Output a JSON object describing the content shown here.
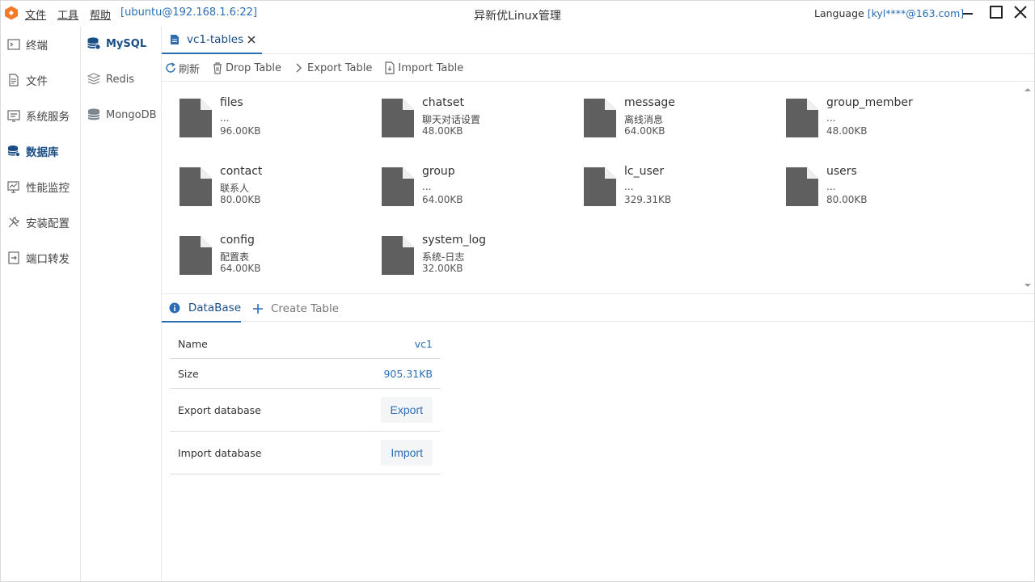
{
  "titlebar": {
    "menus": [
      "文件",
      "工具",
      "帮助"
    ],
    "connection": "[ubuntu@192.168.1.6:22]",
    "title": "异新优Linux管理",
    "language_label": "Language",
    "account": "[kyl****@163.com]"
  },
  "sidebar": {
    "items": [
      {
        "label": "终端",
        "icon": "terminal-icon"
      },
      {
        "label": "文件",
        "icon": "file-icon"
      },
      {
        "label": "系统服务",
        "icon": "service-icon"
      },
      {
        "label": "数据库",
        "icon": "database-icon"
      },
      {
        "label": "性能监控",
        "icon": "monitor-icon"
      },
      {
        "label": "安装配置",
        "icon": "tools-icon"
      },
      {
        "label": "端口转发",
        "icon": "port-forward-icon"
      }
    ],
    "active": "数据库"
  },
  "db_types": {
    "items": [
      {
        "label": "MySQL",
        "icon": "mysql-icon"
      },
      {
        "label": "Redis",
        "icon": "redis-icon"
      },
      {
        "label": "MongoDB",
        "icon": "mongodb-icon"
      }
    ],
    "active": "MySQL"
  },
  "tab": {
    "label": "vc1-tables"
  },
  "toolbar": {
    "refresh": "刷新",
    "drop": "Drop Table",
    "export": "Export Table",
    "import": "Import Table"
  },
  "tables": [
    {
      "name": "files",
      "comment": "...",
      "size": "96.00KB"
    },
    {
      "name": "chatset",
      "comment": "聊天对话设置",
      "size": "48.00KB"
    },
    {
      "name": "message",
      "comment": "离线消息",
      "size": "64.00KB"
    },
    {
      "name": "group_member",
      "comment": "...",
      "size": "48.00KB"
    },
    {
      "name": "contact",
      "comment": "联系人",
      "size": "80.00KB"
    },
    {
      "name": "group",
      "comment": "...",
      "size": "64.00KB"
    },
    {
      "name": "lc_user",
      "comment": "...",
      "size": "329.31KB"
    },
    {
      "name": "users",
      "comment": "...",
      "size": "80.00KB"
    },
    {
      "name": "config",
      "comment": "配置表",
      "size": "64.00KB"
    },
    {
      "name": "system_log",
      "comment": "系统-日志",
      "size": "32.00KB"
    }
  ],
  "bottom_tabs": {
    "database": "DataBase",
    "create": "Create Table"
  },
  "info": {
    "name_label": "Name",
    "name_value": "vc1",
    "size_label": "Size",
    "size_value": "905.31KB",
    "export_label": "Export database",
    "export_button": "Export",
    "import_label": "Import database",
    "import_button": "Import"
  },
  "colors": {
    "accent": "#2a6db5",
    "active_text": "#1a4e86",
    "file_icon": "#5f5f5f",
    "logo": "#f07b2b"
  }
}
